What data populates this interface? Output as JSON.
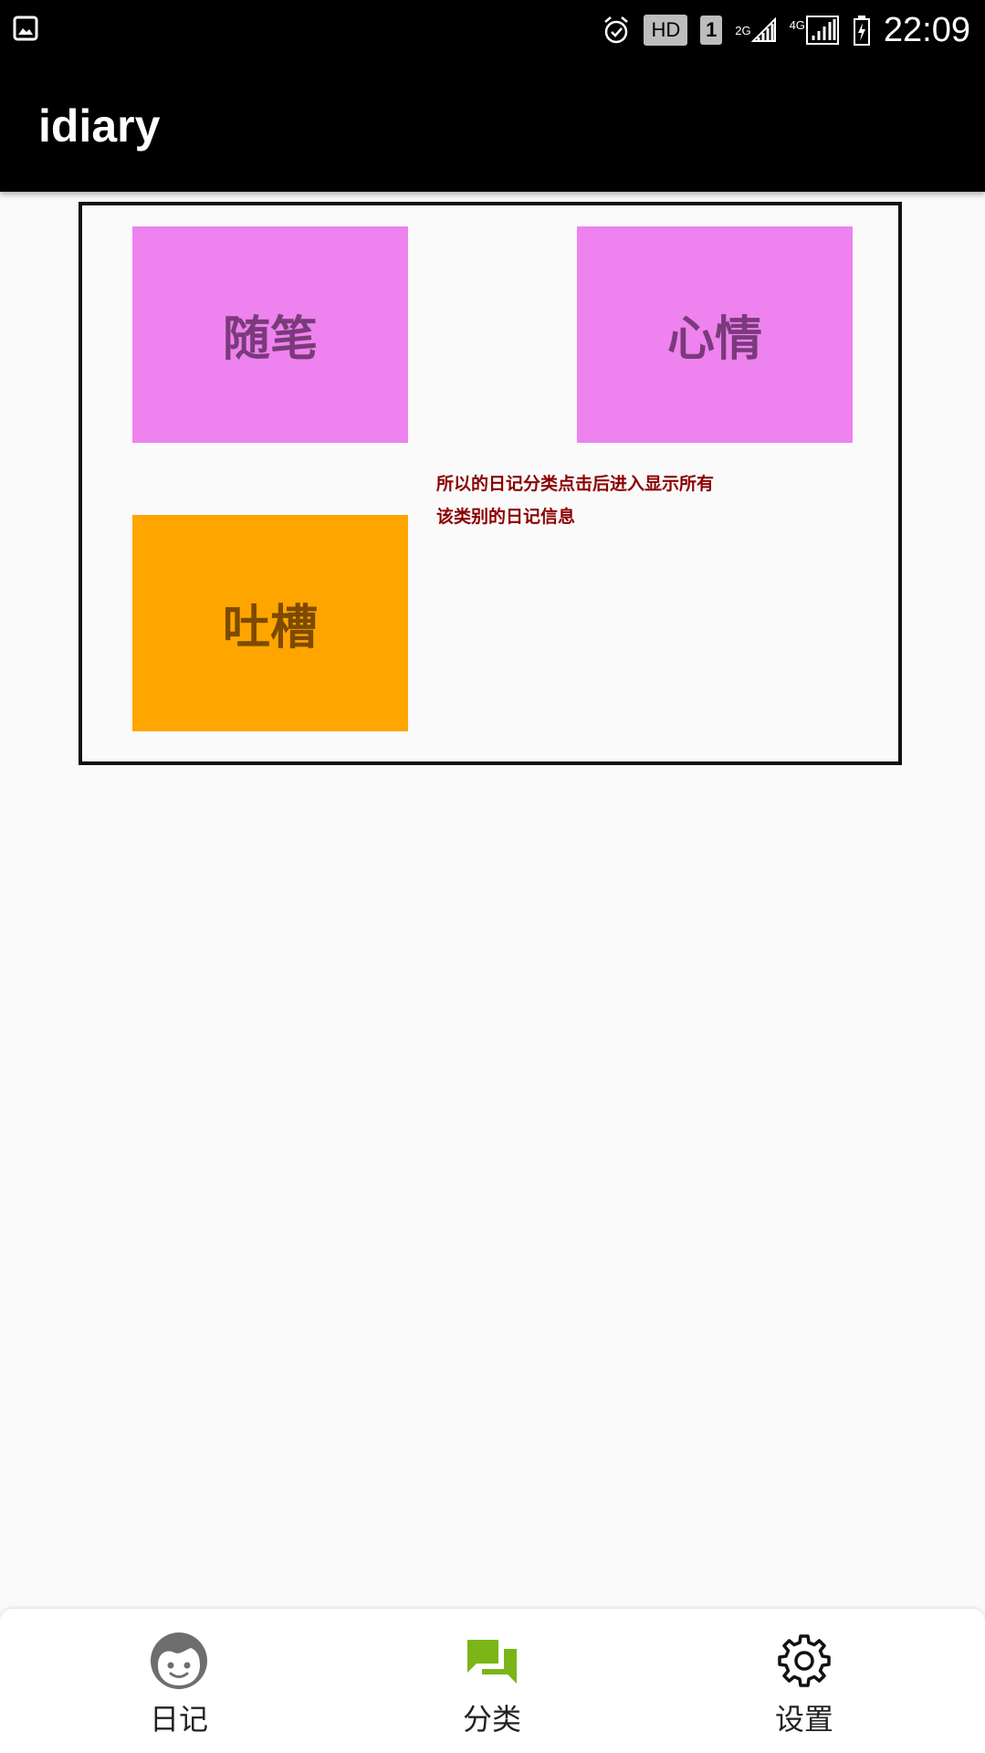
{
  "status_bar": {
    "network_type": "4G",
    "signal_label": "2G",
    "hd_label": "HD",
    "sim_label": "1",
    "time": "22:09"
  },
  "app_bar": {
    "title": "idiary"
  },
  "categories": [
    {
      "label": "随笔",
      "color": "#ee82ee"
    },
    {
      "label": "心情",
      "color": "#ee82ee"
    },
    {
      "label": "吐槽",
      "color": "#ffa500"
    }
  ],
  "hint": {
    "line1": "所以的日记分类点击后进入显示所有",
    "line2": "该类别的日记信息",
    "color": "#8b0000"
  },
  "bottom_nav": {
    "items": [
      {
        "label": "日记",
        "icon": "face-icon",
        "active": false
      },
      {
        "label": "分类",
        "icon": "chat-bubbles-icon",
        "active": true,
        "active_color": "#7cb518"
      },
      {
        "label": "设置",
        "icon": "gear-icon",
        "active": false
      }
    ]
  }
}
